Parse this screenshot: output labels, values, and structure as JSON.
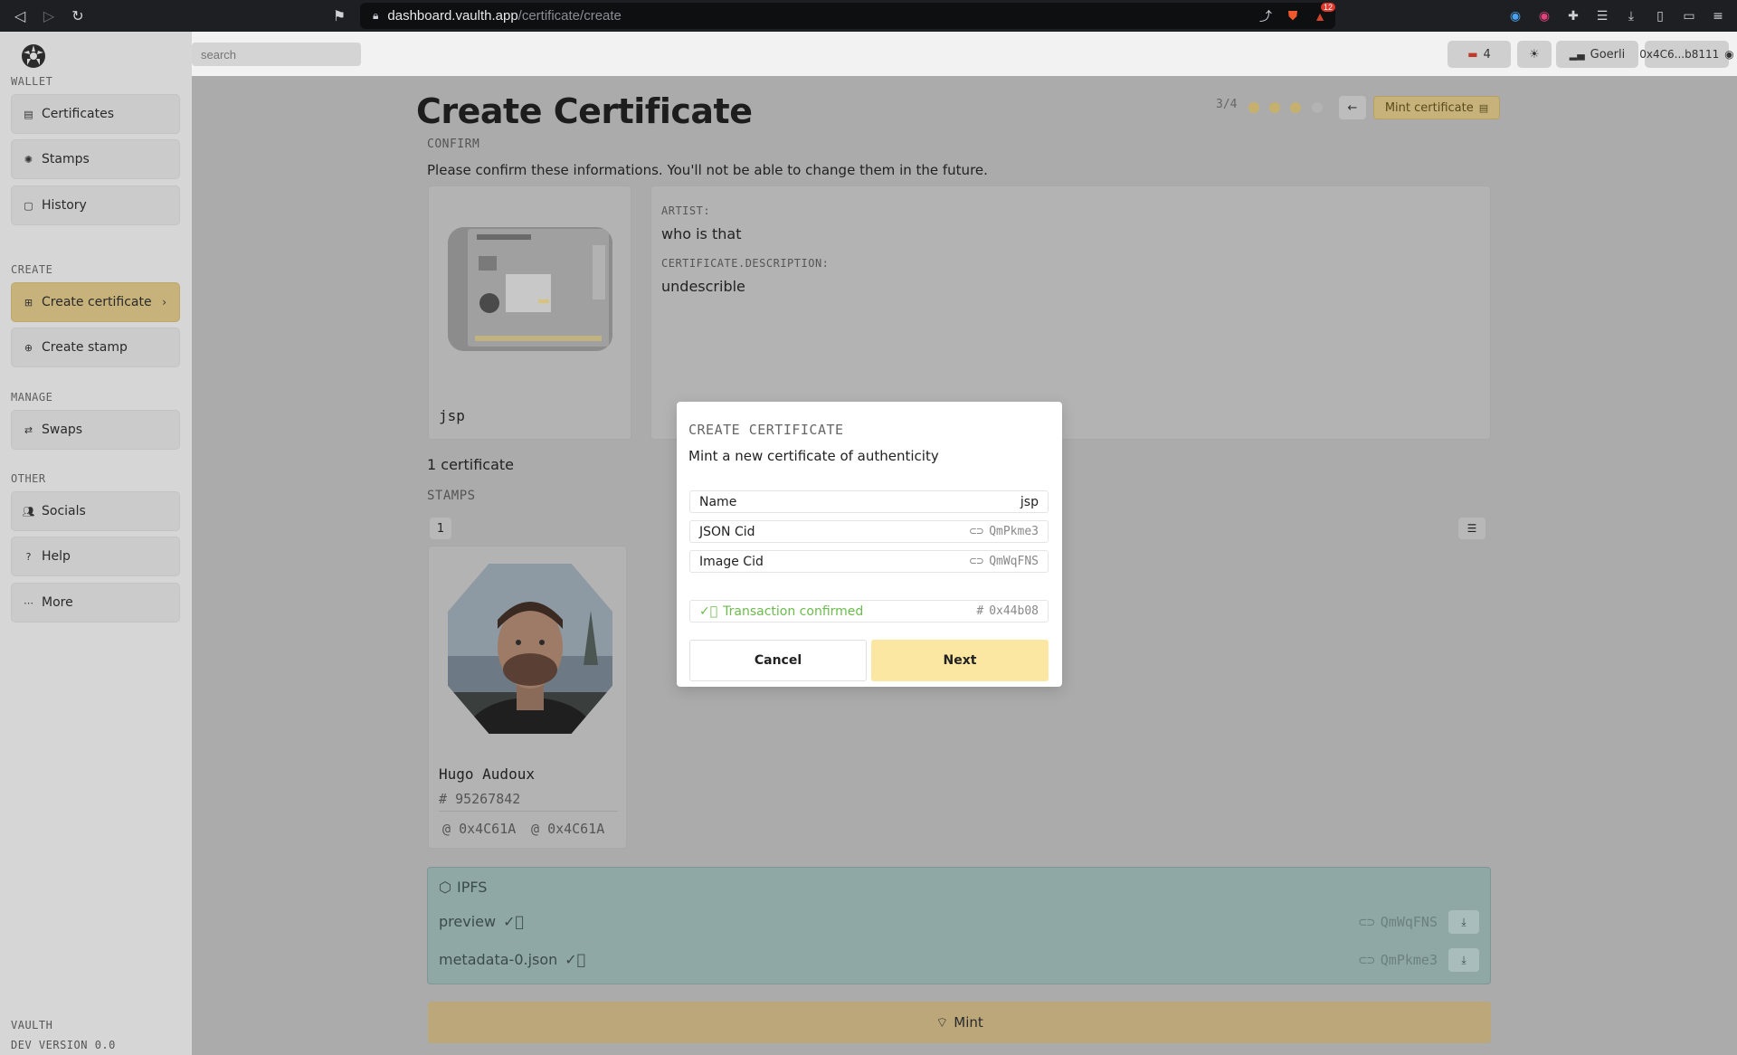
{
  "browser": {
    "url_host": "dashboard.vaulth.app",
    "url_path": "/certificate/create",
    "notif_count": "12"
  },
  "search": {
    "placeholder": "search"
  },
  "topbar": {
    "ticket_count": "4",
    "network": "Goerli",
    "account": "0x4C6...b8111"
  },
  "sidebar": {
    "sections": {
      "wallet": "WALLET",
      "create": "CREATE",
      "manage": "MANAGE",
      "other": "OTHER"
    },
    "items": {
      "certificates": "Certificates",
      "stamps": "Stamps",
      "history": "History",
      "create_certificate": "Create certificate",
      "create_stamp": "Create stamp",
      "swaps": "Swaps",
      "socials": "Socials",
      "help": "Help",
      "more": "More"
    },
    "footer": {
      "name": "VAULTH",
      "version": "DEV VERSION 0.0"
    }
  },
  "page": {
    "title": "Create Certificate",
    "step": "3/4",
    "mint_certificate": "Mint certificate",
    "confirm_label": "CONFIRM",
    "confirm_msg": "Please confirm these informations. You'll not be able to change them in the future.",
    "cert_name": "jsp",
    "artist_label": "ARTIST:",
    "artist_value": "who is that",
    "desc_label": "CERTIFICATE.DESCRIPTION:",
    "desc_value": "undescrible",
    "cert_count": "1 certificate",
    "stamps_label": "STAMPS",
    "page_num": "1",
    "stamp": {
      "name": "Hugo Audoux",
      "number": "95267842",
      "addr1": "0x4C61A",
      "addr2": "0x4C61A"
    },
    "ipfs": {
      "title": "IPFS",
      "rows": [
        {
          "name": "preview",
          "cid": "QmWqFNS"
        },
        {
          "name": "metadata-0.json",
          "cid": "QmPkme3"
        }
      ]
    },
    "mint": "Mint"
  },
  "modal": {
    "title": "CREATE CERTIFICATE",
    "subtitle": "Mint a new certificate of authenticity",
    "name_label": "Name",
    "name_value": "jsp",
    "json_label": "JSON Cid",
    "json_value": "QmPkme3",
    "image_label": "Image Cid",
    "image_value": "QmWqFNS",
    "tx_status": "Transaction confirmed",
    "tx_hash": "0x44b08",
    "cancel": "Cancel",
    "next": "Next"
  },
  "colors": {
    "accent": "#fbe6a2",
    "success": "#6dbb4e"
  }
}
